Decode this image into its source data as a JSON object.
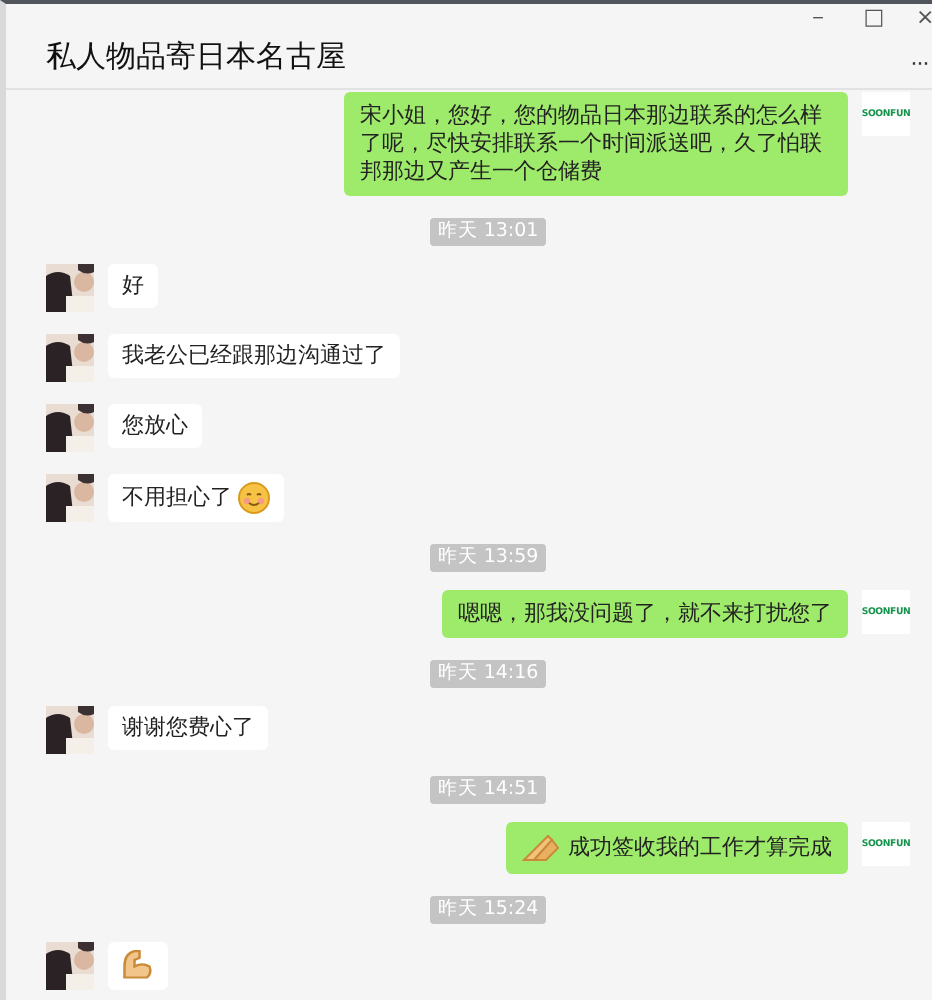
{
  "window": {
    "title": "私人物品寄日本名古屋",
    "controls": [
      "－",
      "□",
      "×"
    ],
    "more": "···"
  },
  "messages": [
    {
      "kind": "out",
      "text": "宋小姐，您好，您的物品日本那边联系的怎么样了呢，尽快安排联系一个时间派送吧，久了怕联邦那边又产生一个仓储费",
      "avatar_text": "SOONFUN"
    },
    {
      "kind": "time",
      "text": "昨天 13:01"
    },
    {
      "kind": "in",
      "text": "好"
    },
    {
      "kind": "in",
      "text": "我老公已经跟那边沟通过了"
    },
    {
      "kind": "in",
      "text": "您放心"
    },
    {
      "kind": "in",
      "text": "不用担心了"
    },
    {
      "kind": "time",
      "text": "昨天 13:59"
    },
    {
      "kind": "out",
      "text": "嗯嗯，那我没问题了，就不来打扰您了",
      "avatar_text": "SOONFUN"
    },
    {
      "kind": "time",
      "text": "昨天 14:16"
    },
    {
      "kind": "in",
      "text": "谢谢您费心了"
    },
    {
      "kind": "time",
      "text": "昨天 14:51"
    },
    {
      "kind": "out",
      "text": "成功签收我的工作才算完成",
      "avatar_text": "SOONFUN"
    },
    {
      "kind": "time",
      "text": "昨天 15:24"
    },
    {
      "kind": "in"
    }
  ]
}
